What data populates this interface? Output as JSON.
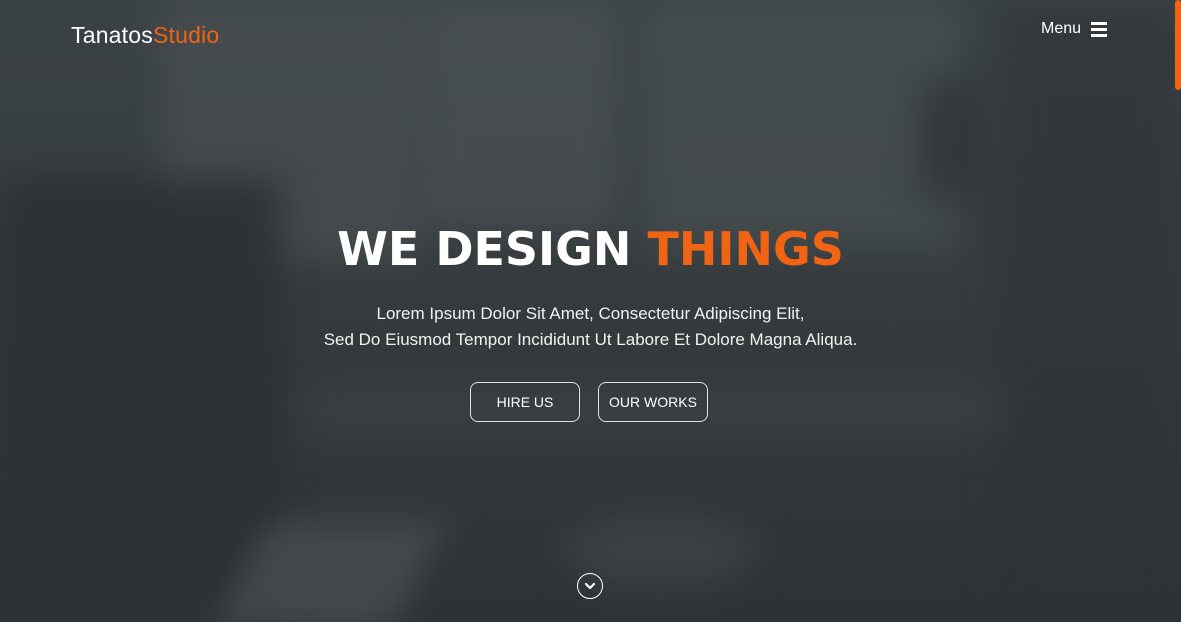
{
  "logo": {
    "first": "Tanatos",
    "second": "Studio"
  },
  "nav": {
    "menu_label": "Menu",
    "menu_icon": "hamburger-icon"
  },
  "hero": {
    "headline_white": "WE DESIGN",
    "headline_orange": "THINGS",
    "subtitle_line1": "Lorem Ipsum Dolor Sit Amet, Consectetur Adipiscing Elit,",
    "subtitle_line2": "Sed Do Eiusmod Tempor Incididunt Ut Labore Et Dolore Magna Aliqua.",
    "buttons": [
      {
        "label": "HIRE US"
      },
      {
        "label": "OUR WORKS"
      }
    ],
    "scroll_icon": "chevron-down-icon"
  },
  "colors": {
    "accent": "#f06414",
    "text": "#ffffff",
    "background": "#353b3e"
  }
}
